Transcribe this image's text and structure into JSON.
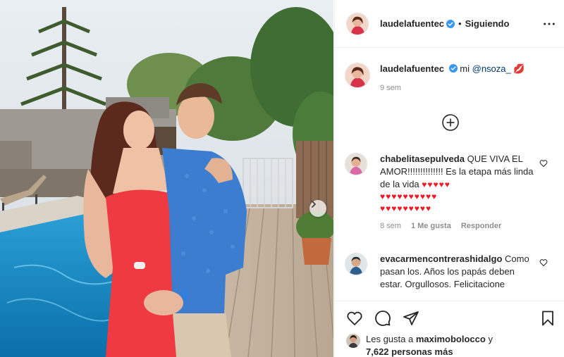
{
  "post": {
    "username": "laudelafuentec",
    "separator": "•",
    "follow_state": "Siguiendo",
    "verified": true
  },
  "caption": {
    "username": "laudelafuentec",
    "text_prefix": "mi",
    "mention": "@nsoza_",
    "emoji": "💋",
    "time": "9 sem"
  },
  "comments": [
    {
      "username": "chabelitasepulveda",
      "text": "QUE VIVA EL AMOR!!!!!!!!!!!!!! Es la etapa más linda de la vida",
      "hearts_line1": "♥♥♥♥♥",
      "hearts_line2": "♥♥♥♥♥♥♥♥♥♥",
      "hearts_line3": "♥♥♥♥♥♥♥♥♥",
      "time": "8 sem",
      "likes": "1 Me gusta",
      "reply": "Responder"
    },
    {
      "username": "evacarmencontrerashidalgo",
      "text": "Como pasan los. Años los papás deben estar. Orgullosos. Felicitacione"
    }
  ],
  "likes": {
    "prefix": "Les gusta a",
    "user": "maximobolocco",
    "conjunction": "y",
    "others": "7,622 personas más"
  },
  "colors": {
    "verified": "#3897f0",
    "mention": "#00376b",
    "heart": "#ed1c24",
    "secondary_text": "#8e8e8e"
  },
  "icons": {
    "more": "more-horizontal-icon",
    "load_more": "plus-circle-icon",
    "like": "heart-outline-icon",
    "comment": "comment-bubble-icon",
    "share": "paper-plane-icon",
    "save": "bookmark-icon",
    "next": "chevron-right-icon"
  }
}
